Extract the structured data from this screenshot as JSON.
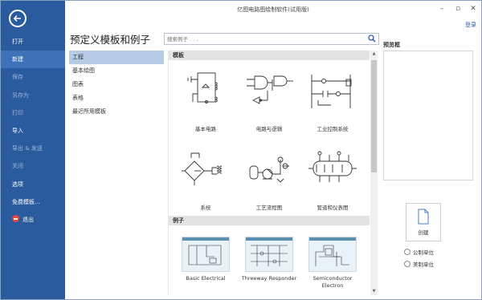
{
  "window": {
    "title": "亿图电路图绘制软件(试用版)",
    "login": "登录"
  },
  "sidebar": {
    "items": [
      {
        "label": "打开",
        "enabled": true
      },
      {
        "label": "新建",
        "enabled": true,
        "active": true
      },
      {
        "label": "保存",
        "enabled": false
      },
      {
        "label": "另存为",
        "enabled": false
      },
      {
        "label": "打印",
        "enabled": false
      },
      {
        "label": "导入",
        "enabled": true
      },
      {
        "label": "导出 & 发送",
        "enabled": false
      },
      {
        "label": "关闭",
        "enabled": false
      },
      {
        "label": "选项",
        "enabled": true
      },
      {
        "label": "免费模板...",
        "enabled": true
      },
      {
        "label": "退出",
        "enabled": true
      }
    ]
  },
  "main": {
    "heading": "预定义模板和例子",
    "search_placeholder": "搜索例子 . . .",
    "categories": [
      "工程",
      "基本绘图",
      "图表",
      "表格",
      "最近所用模板"
    ],
    "sections": {
      "templates": "模板",
      "examples": "例子"
    },
    "templates": [
      "基本电路",
      "电路与逻辑",
      "工业控制系统",
      "系统",
      "工艺流程图",
      "管道和仪表图"
    ],
    "examples": [
      "Basic Electrical",
      "Threeway Responder",
      "Semiconductor Electron"
    ]
  },
  "preview": {
    "label": "预览框",
    "create_label": "创建",
    "units": [
      {
        "label": "公制单位",
        "selected": false
      },
      {
        "label": "美制单位",
        "selected": false
      }
    ]
  },
  "colors": {
    "sidebar": "#2a5b9e",
    "sidebar_active": "#3d72b8",
    "selected_category": "#b7cbe6"
  }
}
